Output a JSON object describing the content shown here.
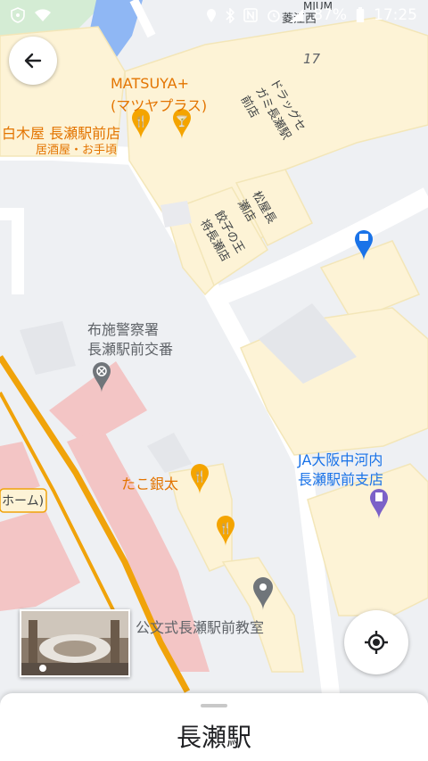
{
  "status_bar": {
    "battery": "87%",
    "time": "17:25",
    "icons": [
      "shield-icon",
      "wifi-icon",
      "location-icon",
      "bluetooth-icon",
      "nfc-icon",
      "alarm-icon",
      "signal-icon",
      "battery-icon"
    ]
  },
  "map": {
    "colors": {
      "background": "#eef0f3",
      "building": "#fdf3d6",
      "building_outline": "#f3e6b8",
      "station": "#f3c5c5",
      "water": "#8fb7f4",
      "park": "#d4ecd4",
      "rail": "#f0a30a",
      "road": "#ffffff"
    },
    "labels": {
      "matsuya_line1": "MATSUYA+",
      "matsuya_line2": "(マツヤプラス)",
      "shirokiya": "白木屋 長瀬駅前店",
      "shirokiya_category": "居酒屋・お手頃",
      "drugstore": "ドラッグセガミ長瀬駅前店",
      "matsuya_shop": "松屋長瀬店",
      "gyoza": "餃子の王将長瀬店",
      "police_line1": "布施警察署",
      "police_line2": "長瀬駅前交番",
      "tako": "たこ銀太",
      "ja_line1": "JA大阪中河内",
      "ja_line2": "長瀬駅前支店",
      "kumon": "公文式長瀬駅前教室",
      "platform": "ホーム)",
      "block_number": "17",
      "area_name": "菱江西",
      "top_cut": "MIUM"
    }
  },
  "controls": {
    "back": "back-arrow-icon",
    "locate": "my-location-icon",
    "street_view": "street-view-thumbnail"
  },
  "sheet": {
    "title": "長瀬駅"
  }
}
